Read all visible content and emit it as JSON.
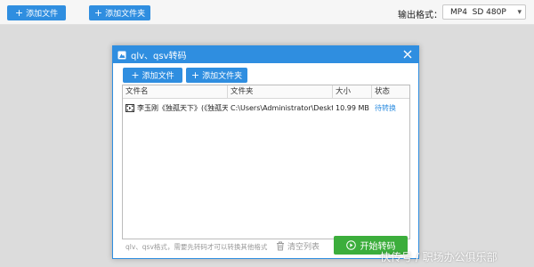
{
  "toolbar": {
    "add_file_label": "添加文件",
    "add_folder_label": "添加文件夹",
    "output_format_label": "输出格式：",
    "output_format_value": "MP4  SD 480P"
  },
  "dialog": {
    "title": "qlv、qsv转码",
    "add_file_label": "添加文件",
    "add_folder_label": "添加文件夹",
    "table": {
      "headers": [
        "文件名",
        "文件夹",
        "大小",
        "状态"
      ],
      "rows": [
        {
          "name": "李玉刚《独孤天下》(《独孤天",
          "folder": "C:\\Users\\Administrator\\Desktop",
          "size": "10.99 MB",
          "status": "待转换"
        }
      ]
    },
    "footer_note": "qlv、qsv格式，需要先转码才可以转换其他格式",
    "clear_list_label": "清空列表",
    "start_label": "开始转码"
  },
  "watermark": "快传号 / 职场办公俱乐部",
  "colors": {
    "accent": "#2f8ee0",
    "start_button": "#3cae3c",
    "status_text": "#2f8ee0"
  },
  "icons": {
    "add": "plus-icon",
    "app": "app-icon",
    "close": "close-icon",
    "file": "film-icon",
    "clear": "trash-icon",
    "start": "play-icon",
    "dropdown": "chevron-down-icon"
  }
}
